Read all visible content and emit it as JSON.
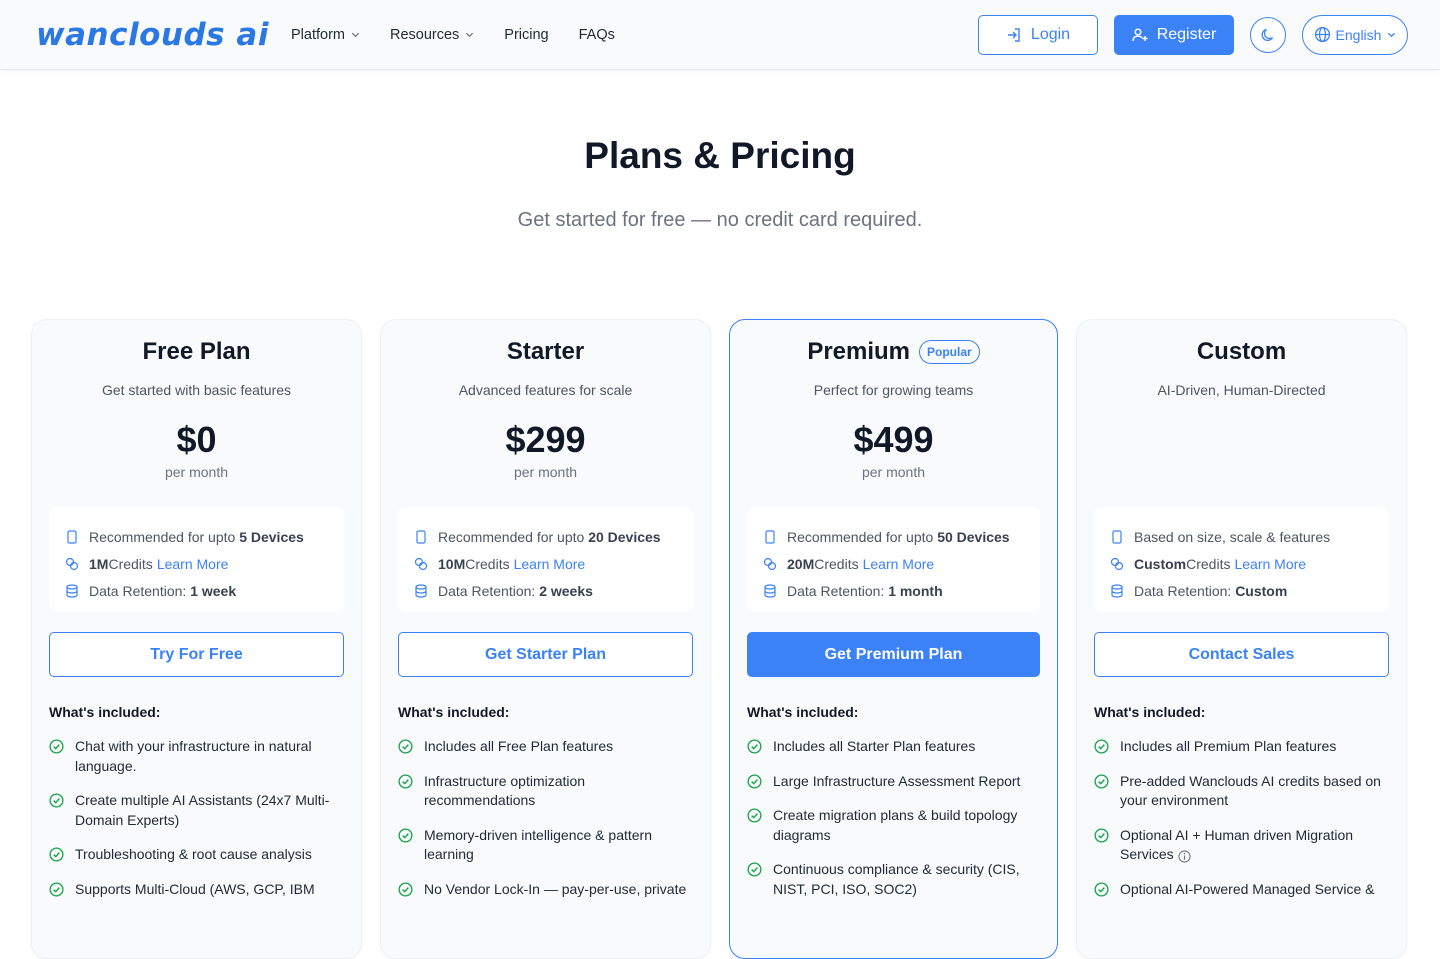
{
  "header": {
    "logo": "wanclouds ai",
    "nav": [
      {
        "label": "Platform",
        "dropdown": true
      },
      {
        "label": "Resources",
        "dropdown": true
      },
      {
        "label": "Pricing",
        "dropdown": false
      },
      {
        "label": "FAQs",
        "dropdown": false
      }
    ],
    "login_label": "Login",
    "register_label": "Register",
    "language": "English"
  },
  "hero": {
    "title": "Plans & Pricing",
    "subtitle": "Get started for free — no credit card required."
  },
  "colors": {
    "accent": "#3b82f6",
    "check": "#16a34a"
  },
  "plans": [
    {
      "name": "Free Plan",
      "badge": "",
      "description": "Get started with basic features",
      "price": "$0",
      "period": "per month",
      "devices_prefix": "Recommended for upto ",
      "devices_value": "5 Devices",
      "credits_value": "1M",
      "credits_label": " Credits",
      "learn_more": "Learn More",
      "retention_prefix": "Data Retention: ",
      "retention_value": "1 week",
      "cta": "Try For Free",
      "included_title": "What's included:",
      "features": [
        "Chat with your infrastructure in natural language.",
        "Create multiple AI Assistants (24x7 Multi-Domain Experts)",
        "Troubleshooting & root cause analysis",
        "Supports Multi-Cloud (AWS, GCP, IBM"
      ]
    },
    {
      "name": "Starter",
      "badge": "",
      "description": "Advanced features for scale",
      "price": "$299",
      "period": "per month",
      "devices_prefix": "Recommended for upto ",
      "devices_value": "20 Devices",
      "credits_value": "10M",
      "credits_label": " Credits",
      "learn_more": "Learn More",
      "retention_prefix": "Data Retention: ",
      "retention_value": "2 weeks",
      "cta": "Get Starter Plan",
      "included_title": "What's included:",
      "features": [
        "Includes all Free Plan features",
        "Infrastructure optimization recommendations",
        "Memory-driven intelligence & pattern learning",
        "No Vendor Lock-In — pay-per-use, private"
      ]
    },
    {
      "name": "Premium",
      "badge": "Popular",
      "description": "Perfect for growing teams",
      "price": "$499",
      "period": "per month",
      "devices_prefix": "Recommended for upto ",
      "devices_value": "50 Devices",
      "credits_value": "20M",
      "credits_label": " Credits",
      "learn_more": "Learn More",
      "retention_prefix": "Data Retention: ",
      "retention_value": "1 month",
      "cta": "Get Premium Plan",
      "included_title": "What's included:",
      "features": [
        "Includes all Starter Plan features",
        "Large Infrastructure Assessment Report",
        "Create migration plans & build topology diagrams",
        "Continuous compliance & security (CIS, NIST, PCI, ISO, SOC2)"
      ]
    },
    {
      "name": "Custom",
      "badge": "",
      "description": "AI-Driven, Human-Directed",
      "price": "",
      "period": "",
      "devices_prefix": "Based on size, scale & features",
      "devices_value": "",
      "credits_value": "Custom",
      "credits_label": " Credits",
      "learn_more": "Learn More",
      "retention_prefix": "Data Retention: ",
      "retention_value": "Custom",
      "cta": "Contact Sales",
      "included_title": "What's included:",
      "features": [
        "Includes all Premium Plan features",
        "Pre-added Wanclouds AI credits based on your environment",
        "Optional AI + Human driven Migration Services",
        "Optional AI-Powered Managed Service &"
      ]
    }
  ]
}
